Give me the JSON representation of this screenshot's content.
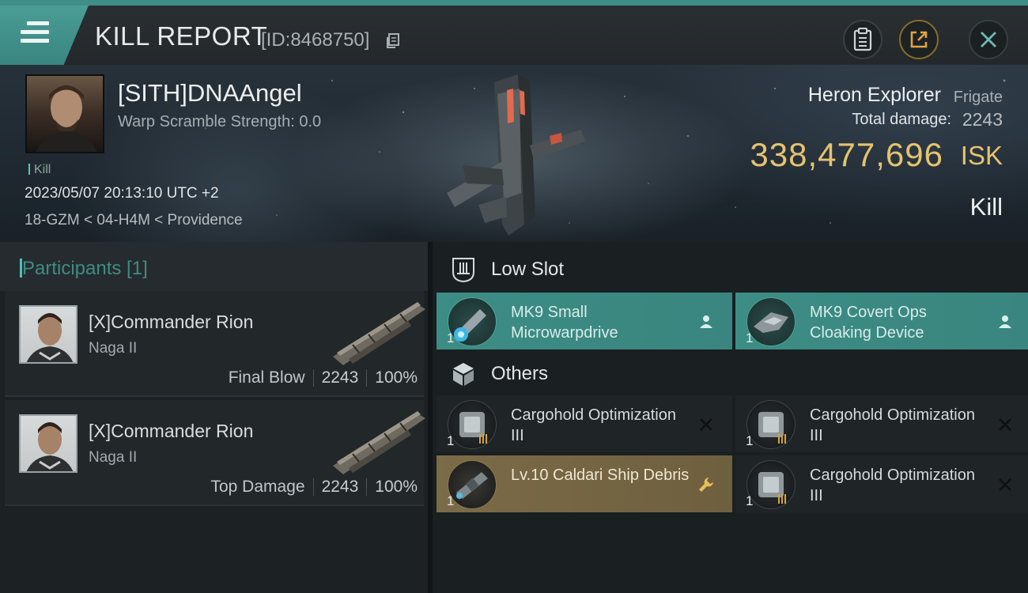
{
  "header": {
    "title": "KILL REPORT",
    "report_id": "[ID:8468750]"
  },
  "victim": {
    "name": "[SITH]DNAAngel",
    "warp_scramble": "Warp Scramble Strength: 0.0",
    "tag": "Kill",
    "datetime": "2023/05/07 20:13:10 UTC +2",
    "location": "18-GZM < 04-H4M < Providence",
    "ship_name": "Heron Explorer",
    "ship_class": "Frigate",
    "total_damage_label": "Total damage:",
    "total_damage": "2243",
    "isk_value": "338,477,696",
    "isk_unit": "ISK",
    "result": "Kill"
  },
  "participants": {
    "title": "Participants [1]",
    "items": [
      {
        "name": "[X]Commander Rion",
        "ship": "Naga II",
        "label": "Final Blow",
        "damage": "2243",
        "percent": "100%"
      },
      {
        "name": "[X]Commander Rion",
        "ship": "Naga II",
        "label": "Top Damage",
        "damage": "2243",
        "percent": "100%"
      }
    ]
  },
  "low_slot": {
    "title": "Low Slot",
    "items": [
      {
        "name": "MK9 Small Microwarpdrive",
        "qty": "1",
        "action_icon": "person-icon",
        "color": "#3c8d85"
      },
      {
        "name": "MK9 Covert Ops Cloaking Device",
        "qty": "1",
        "action_icon": "person-icon",
        "color": "#3c8d85"
      }
    ]
  },
  "others": {
    "title": "Others",
    "items": [
      {
        "name": "Cargohold Optimization III",
        "qty": "1",
        "action_icon": "close-icon"
      },
      {
        "name": "Cargohold Optimization III",
        "qty": "1",
        "action_icon": "close-icon"
      },
      {
        "name": "Lv.10 Caldari Ship Debris",
        "qty": "1",
        "action_icon": "wrench-icon",
        "color": "#7b6b47"
      },
      {
        "name": "Cargohold Optimization III",
        "qty": "1",
        "action_icon": "close-icon"
      }
    ]
  },
  "colors": {
    "accent": "#3f8f88",
    "isk": "#e6c36f"
  }
}
